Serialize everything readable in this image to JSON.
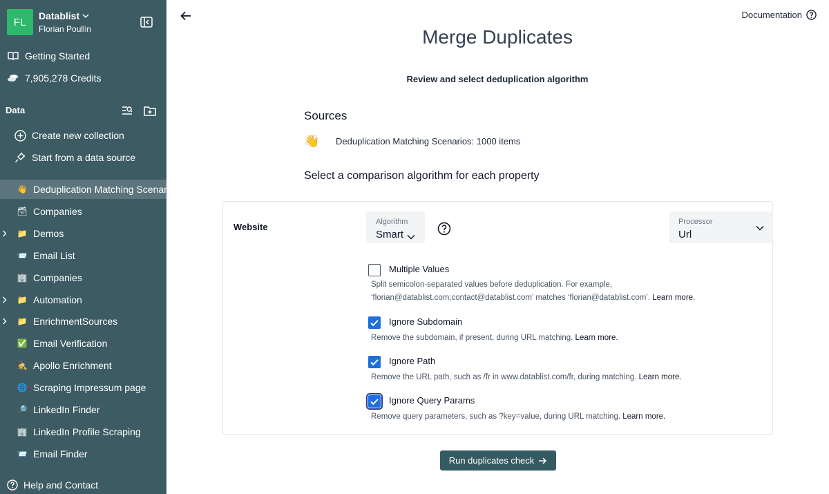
{
  "workspace": {
    "initials": "FL",
    "name": "Datablist",
    "user": "Florian Poullin"
  },
  "nav": {
    "getting_started": "Getting Started",
    "credits": "7,905,278 Credits"
  },
  "data_section": {
    "title": "Data",
    "create": "Create new collection",
    "start_source": "Start from a data source"
  },
  "collections": [
    {
      "emoji": "👋",
      "label": "Deduplication Matching Scenarios",
      "active": true,
      "folder": false
    },
    {
      "emoji": "🗃",
      "label": "Companies",
      "active": false,
      "folder": false
    },
    {
      "emoji": "📁",
      "label": "Demos",
      "active": false,
      "folder": true
    },
    {
      "emoji": "📨",
      "label": "Email List",
      "active": false,
      "folder": false
    },
    {
      "emoji": "🏢",
      "label": "Companies",
      "active": false,
      "folder": false
    },
    {
      "emoji": "📁",
      "label": "Automation",
      "active": false,
      "folder": true
    },
    {
      "emoji": "📁",
      "label": "EnrichmentSources",
      "active": false,
      "folder": true
    },
    {
      "emoji": "✅",
      "label": "Email Verification",
      "active": false,
      "folder": false
    },
    {
      "emoji": "🕵",
      "label": "Apollo Enrichment",
      "active": false,
      "folder": false
    },
    {
      "emoji": "🌐",
      "label": "Scraping Impressum page",
      "active": false,
      "folder": false
    },
    {
      "emoji": "🔎",
      "label": "LinkedIn Finder",
      "active": false,
      "folder": false
    },
    {
      "emoji": "🏢",
      "label": "LinkedIn Profile Scraping",
      "active": false,
      "folder": false
    },
    {
      "emoji": "📨",
      "label": "Email Finder",
      "active": false,
      "folder": false
    }
  ],
  "help": "Help and Contact",
  "header": {
    "documentation": "Documentation"
  },
  "main": {
    "title": "Merge Duplicates",
    "subtitle": "Review and select deduplication algorithm",
    "sources_heading": "Sources",
    "source": {
      "emoji": "👋",
      "text": "Deduplication Matching Scenarios: 1000 items"
    },
    "select_heading": "Select a comparison algorithm for each property"
  },
  "property": {
    "name": "Website",
    "algorithm": {
      "caption": "Algorithm",
      "value": "Smart"
    },
    "processor": {
      "caption": "Processor",
      "value": "Url"
    },
    "options": [
      {
        "label": "Multiple Values",
        "checked": false,
        "focused": false,
        "desc": "Split semicolon-separated values before deduplication. For example, ‘florian@datablist.com;contact@datablist.com’ matches ‘florian@datablist.com’.",
        "learn": "Learn more."
      },
      {
        "label": "Ignore Subdomain",
        "checked": true,
        "focused": false,
        "desc": "Remove the subdomain, if present, during URL matching.",
        "learn": "Learn more."
      },
      {
        "label": "Ignore Path",
        "checked": true,
        "focused": false,
        "desc": "Remove the URL path, such as /fr in www.datablist.com/fr, during matching.",
        "learn": "Learn more."
      },
      {
        "label": "Ignore Query Params",
        "checked": true,
        "focused": true,
        "desc": "Remove query parameters, such as ?key=value, during URL matching.",
        "learn": "Learn more."
      }
    ]
  },
  "run_button": "Run duplicates check",
  "colors": {
    "sidebar": "#3d5b63",
    "accent": "#365a62",
    "checkbox": "#1d6fdc",
    "avatar": "#2eb86b"
  }
}
